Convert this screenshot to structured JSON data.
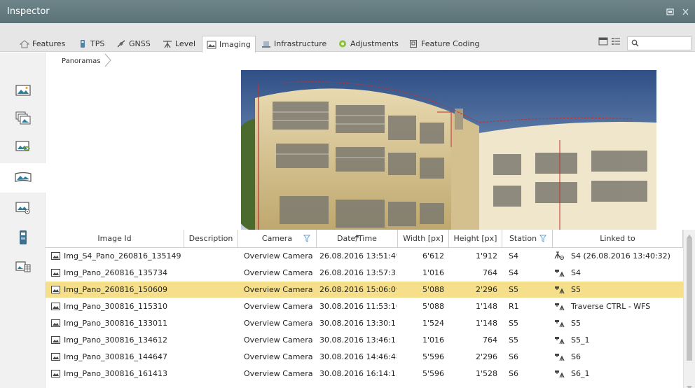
{
  "window": {
    "title": "Inspector"
  },
  "tabs": [
    {
      "label": "Features",
      "icon": "features-icon"
    },
    {
      "label": "TPS",
      "icon": "tps-icon"
    },
    {
      "label": "GNSS",
      "icon": "gnss-icon"
    },
    {
      "label": "Level",
      "icon": "level-icon"
    },
    {
      "label": "Imaging",
      "icon": "imaging-icon",
      "active": true
    },
    {
      "label": "Infrastructure",
      "icon": "infrastructure-icon"
    },
    {
      "label": "Adjustments",
      "icon": "adjustments-icon"
    },
    {
      "label": "Feature Coding",
      "icon": "feature-coding-icon"
    }
  ],
  "breadcrumb": {
    "item": "Panoramas"
  },
  "search": {
    "value": ""
  },
  "table": {
    "headers": [
      "Image Id",
      "Description",
      "Camera",
      "Date/Time",
      "Width [px]",
      "Height [px]",
      "Station",
      "Linked to"
    ],
    "rows": [
      {
        "id": "Img_S4_Pano_260816_135149",
        "description": "",
        "camera": "Overview Camera",
        "datetime": "26.08.2016 13:51:49",
        "width": "6'612",
        "height": "1'912",
        "station": "S4",
        "linked": "S4 (26.08.2016 13:40:32)",
        "linked_icon": "instrument-station-icon"
      },
      {
        "id": "Img_Pano_260816_135734",
        "description": "",
        "camera": "Overview Camera",
        "datetime": "26.08.2016 13:57:35",
        "width": "1'016",
        "height": "764",
        "station": "S4",
        "linked": "S4",
        "linked_icon": "setup-station-icon"
      },
      {
        "id": "Img_Pano_260816_150609",
        "description": "",
        "camera": "Overview Camera",
        "datetime": "26.08.2016 15:06:09",
        "width": "5'088",
        "height": "2'296",
        "station": "S5",
        "linked": "S5",
        "linked_icon": "setup-station-icon",
        "selected": true
      },
      {
        "id": "Img_Pano_300816_115310",
        "description": "",
        "camera": "Overview Camera",
        "datetime": "30.08.2016 11:53:10",
        "width": "5'088",
        "height": "1'148",
        "station": "R1",
        "linked": "Traverse CTRL - WFS",
        "linked_icon": "setup-station-icon"
      },
      {
        "id": "Img_Pano_300816_133011",
        "description": "",
        "camera": "Overview Camera",
        "datetime": "30.08.2016 13:30:11",
        "width": "1'524",
        "height": "1'148",
        "station": "S5",
        "linked": "S5",
        "linked_icon": "setup-station-icon"
      },
      {
        "id": "Img_Pano_300816_134612",
        "description": "",
        "camera": "Overview Camera",
        "datetime": "30.08.2016 13:46:13",
        "width": "1'016",
        "height": "764",
        "station": "S5",
        "linked": "S5_1",
        "linked_icon": "setup-station-icon"
      },
      {
        "id": "Img_Pano_300816_144647",
        "description": "",
        "camera": "Overview Camera",
        "datetime": "30.08.2016 14:46:48",
        "width": "5'596",
        "height": "2'296",
        "station": "S6",
        "linked": "S6",
        "linked_icon": "setup-station-icon"
      },
      {
        "id": "Img_Pano_300816_161413",
        "description": "",
        "camera": "Overview Camera",
        "datetime": "30.08.2016 16:14:13",
        "width": "5'596",
        "height": "1'528",
        "station": "S6",
        "linked": "S6_1",
        "linked_icon": "setup-station-icon"
      }
    ]
  },
  "colors": {
    "titlebar": "#5f767b",
    "selected_row": "#f6df8a",
    "accent": "#3a7ea8"
  }
}
